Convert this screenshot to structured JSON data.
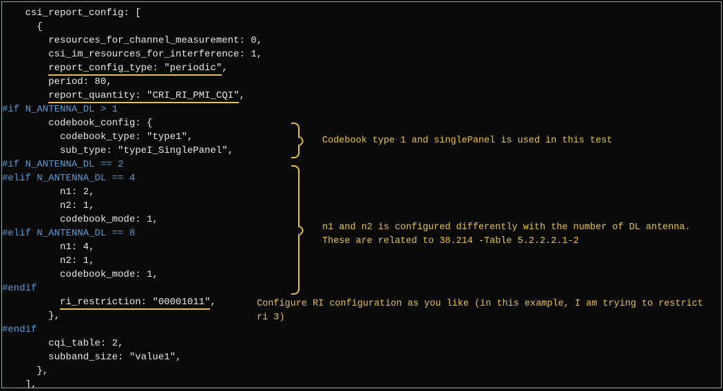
{
  "code": {
    "l1": "    csi_report_config: [",
    "l2": "      {",
    "l3": "        resources_for_channel_measurement: 0,",
    "l4": "        csi_im_resources_for_interference: 1,",
    "l5a": "        ",
    "l5b": "report_config_type: \"periodic\"",
    "l5c": ",",
    "l6": "        period: 80,",
    "l7a": "        ",
    "l7b": "report_quantity: \"CRI_RI_PMI_CQI\"",
    "l7c": ",",
    "l8": "#if N_ANTENNA_DL > 1",
    "l9": "        codebook_config: {",
    "l10": "          codebook_type: \"type1\",",
    "l11": "          sub_type: \"typeI_SinglePanel\",",
    "l12": "#if N_ANTENNA_DL == 2",
    "l13": "#elif N_ANTENNA_DL == 4",
    "l14": "          n1: 2,",
    "l15": "          n2: 1,",
    "l16": "          codebook_mode: 1,",
    "l17": "#elif N_ANTENNA_DL == 8",
    "l18": "          n1: 4,",
    "l19": "          n2: 1,",
    "l20": "          codebook_mode: 1,",
    "l21": "#endif",
    "l22a": "          ",
    "l22b": "ri_restriction: \"00001011\"",
    "l22c": ",",
    "l23": "        },",
    "l24": "#endif",
    "l25": "        cqi_table: 2,",
    "l26": "        subband_size: \"value1\",",
    "l27": "      },",
    "l28": "    ],"
  },
  "annotations": {
    "a1": "Codebook type 1 and singlePanel is used in this test",
    "a2": "n1 and n2 is configured differently with the number of DL antenna. These are related to 38.214 -Table 5.2.2.2.1-2",
    "a3": "Configure RI configuration as you like (in this example, I am trying to restrict ri 3)"
  }
}
